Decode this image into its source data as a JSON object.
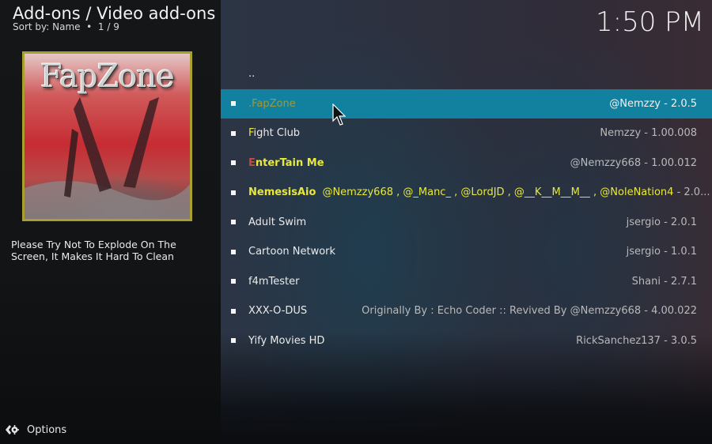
{
  "header": {
    "title": "Add-ons / Video add-ons",
    "sort_label": "Sort by: Name",
    "separator": "•",
    "position": "1 / 9"
  },
  "clock": "1:50 PM",
  "preview": {
    "thumbnail_title": "FapZone",
    "thumbnail_icon": "addon-thumbnail",
    "description": "Please Try Not To Explode On The Screen, It Makes It Hard To Clean"
  },
  "footer": {
    "options_label": "Options",
    "options_icon": "options-icon"
  },
  "list": {
    "parent_label": "..",
    "items": [
      {
        "name": ".FapZone",
        "meta": "@Nemzzy - 2.0.5",
        "selected": true
      },
      {
        "name_first": "F",
        "name_rest": "ight Club",
        "meta": "Nemzzy - 1.00.008"
      },
      {
        "name_first": "E",
        "name_rest": "nterTain Me",
        "meta": "@Nemzzy668 - 1.00.012"
      },
      {
        "name": "NemesisAio",
        "authors": "@Nemzzy668 , @_Manc_ , @LordJD , @__K__M__M__ , @NoleNation4",
        "meta": " - 2.0..."
      },
      {
        "name": "Adult Swim",
        "meta": "jsergio - 2.0.1"
      },
      {
        "name": "Cartoon Network",
        "meta": "jsergio - 1.0.1"
      },
      {
        "name": "f4mTester",
        "meta": "Shani - 2.7.1"
      },
      {
        "name": "XXX-O-DUS",
        "meta": "Originally By : Echo Coder :: Revived By @Nemzzy668 - 4.00.022"
      },
      {
        "name": "Yify Movies HD",
        "meta": "RickSanchez137 - 3.0.5"
      }
    ]
  },
  "colors": {
    "selection": "#12809f",
    "highlight_yellow": "#e8e83a",
    "highlight_red": "#c84a3a",
    "thumbnail_border": "#a8a030"
  }
}
